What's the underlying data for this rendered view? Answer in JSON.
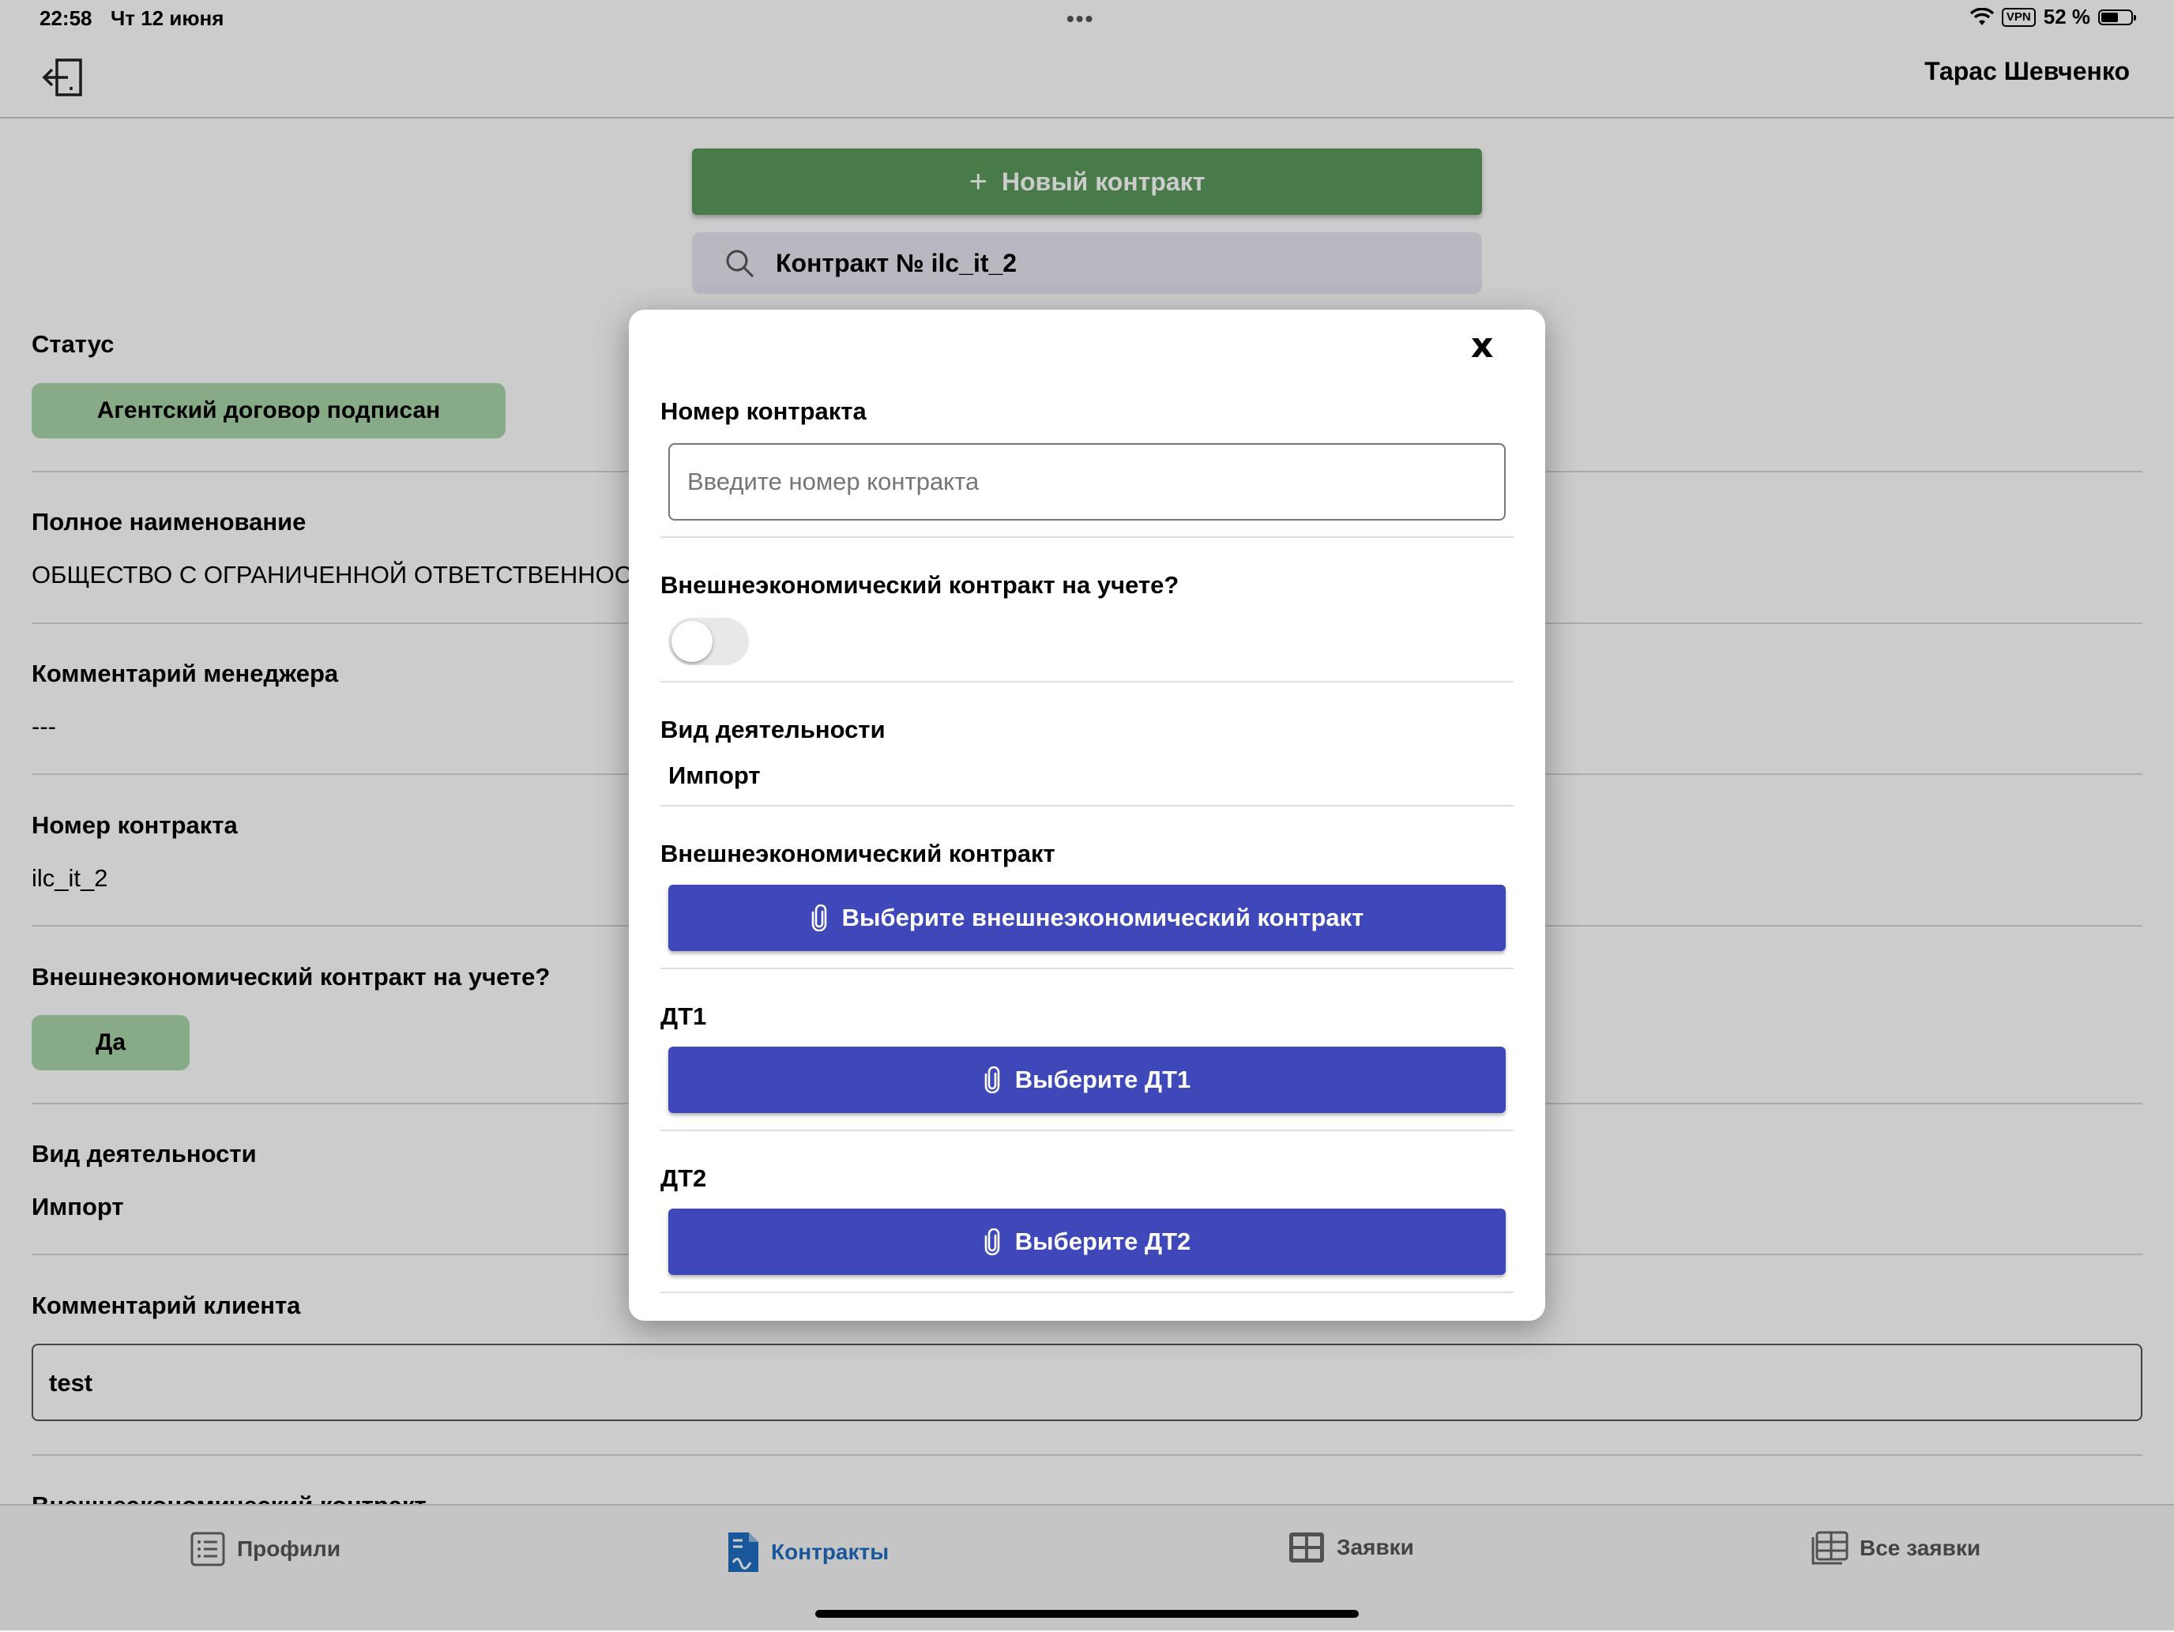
{
  "status_bar": {
    "time": "22:58",
    "date": "Чт 12 июня",
    "dots": "•••",
    "vpn": "VPN",
    "battery": "52 %"
  },
  "header": {
    "user_name": "Тарас Шевченко",
    "logout_icon": "logout-icon"
  },
  "actions": {
    "new_contract_label": "Новый контракт",
    "search_value": "Контракт № ilc_it_2"
  },
  "background_form": {
    "status_label": "Статус",
    "status_value": "Агентский договор подписан",
    "full_name_label": "Полное наименование",
    "full_name_value": "ОБЩЕСТВО С ОГРАНИЧЕННОЙ ОТВЕТСТВЕННОС",
    "manager_comment_label": "Комментарий менеджера",
    "manager_comment_value": "---",
    "contract_number_label": "Номер контракта",
    "contract_number_value": "ilc_it_2",
    "registered_label": "Внешнеэкономический контракт на учете?",
    "registered_value": "Да",
    "activity_label": "Вид деятельности",
    "activity_value": "Импорт",
    "client_comment_label": "Комментарий клиента",
    "client_comment_value": "test",
    "foreign_contract_label_partial": "Внешнеэкономический контракт"
  },
  "modal": {
    "close_label": "x",
    "contract_number_label": "Номер контракта",
    "contract_number_placeholder": "Введите номер контракта",
    "registered_label": "Внешнеэкономический контракт на учете?",
    "registered_on": false,
    "activity_label": "Вид деятельности",
    "activity_value": "Импорт",
    "foreign_contract_label": "Внешнеэкономический контракт",
    "foreign_contract_button": "Выберите внешнеэкономический контракт",
    "dt1_label": "ДТ1",
    "dt1_button": "Выберите ДТ1",
    "dt2_label": "ДТ2",
    "dt2_button": "Выберите ДТ2"
  },
  "tabs": [
    {
      "label": "Профили",
      "icon": "list-icon",
      "active": false
    },
    {
      "label": "Контракты",
      "icon": "document-icon",
      "active": true
    },
    {
      "label": "Заявки",
      "icon": "grid-icon",
      "active": false
    },
    {
      "label": "Все заявки",
      "icon": "table-icon",
      "active": false
    }
  ],
  "colors": {
    "new_button": "#5b9a5c",
    "upload_button": "#3f48b8",
    "status_pill": "#a8d6a8",
    "active_tab": "#1e6fc1"
  }
}
